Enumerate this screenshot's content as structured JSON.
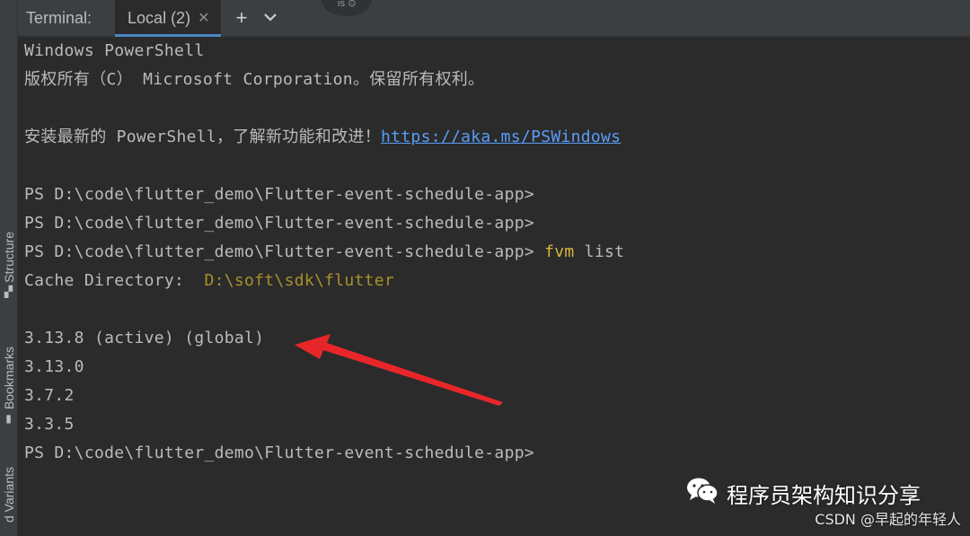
{
  "tabs": {
    "label": "Terminal:",
    "active_tab": "Local (2)",
    "close_icon": "close-icon",
    "add_icon": "plus-icon",
    "dropdown_icon": "chevron-down-icon",
    "notch_text": "ıs  ⊙"
  },
  "side_strip": {
    "items": [
      {
        "label": "Structure",
        "icon": "structure-icon"
      },
      {
        "label": "Bookmarks",
        "icon": "bookmark-icon"
      },
      {
        "label": "d Variants",
        "icon": "variants-icon"
      }
    ]
  },
  "terminal": {
    "line1": "Windows PowerShell",
    "line2": "版权所有（C） Microsoft Corporation。保留所有权利。",
    "line4_text": "安装最新的 PowerShell，了解新功能和改进！",
    "line4_link": "https://aka.ms/PSWindows",
    "prompt": "PS D:\\code\\flutter_demo\\Flutter-event-schedule-app>",
    "command_name": "fvm",
    "command_arg": " list",
    "cache_label": "Cache Directory:  ",
    "cache_path": "D:\\soft\\sdk\\flutter",
    "versions": [
      "3.13.8 (active) (global)",
      "3.13.0",
      "3.7.2",
      "3.3.5"
    ]
  },
  "watermark": {
    "title": "程序员架构知识分享",
    "source": "CSDN @早起的年轻人",
    "icon": "wechat-icon"
  },
  "colors": {
    "background": "#2b2b2b",
    "text": "#bbbbbb",
    "link": "#589df6",
    "command": "#d5b63a",
    "path": "#a8902a",
    "arrow": "#e8262a",
    "tab_underline": "#4a88c7"
  }
}
